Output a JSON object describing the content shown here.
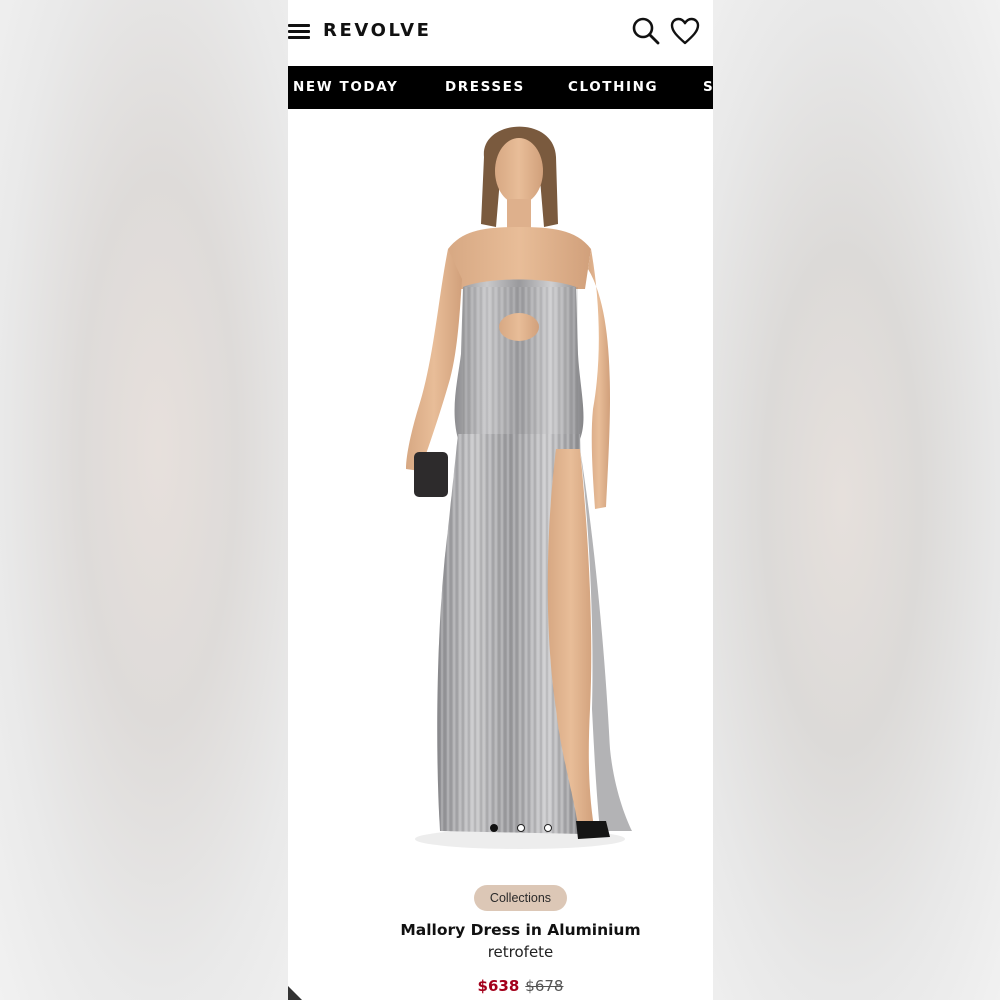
{
  "header": {
    "logo": "REVOLVE",
    "menu_icon": "hamburger-menu-icon",
    "search_icon": "search-icon",
    "wishlist_icon": "heart-icon"
  },
  "nav": {
    "items": [
      "NEW TODAY",
      "DRESSES",
      "CLOTHING",
      "S"
    ]
  },
  "product": {
    "image_alt": "model-wearing-metallic-silver-strapless-pleated-gown",
    "carousel": {
      "total": 3,
      "active": 1
    },
    "badge": "Collections",
    "name": "Mallory Dress in Aluminium",
    "brand": "retrofete",
    "price_sale": "$638",
    "price_original": "$678"
  },
  "colors": {
    "nav_bg": "#000000",
    "sale_price": "#a3001b",
    "badge_bg": "#dcc7b6",
    "dress_silver": "#a9a9ab"
  }
}
